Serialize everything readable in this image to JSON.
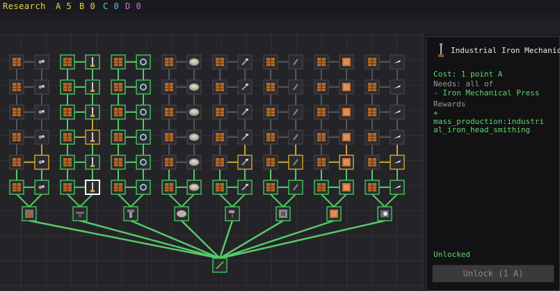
{
  "hud": {
    "research_label": "Research",
    "points": [
      {
        "label": "A 5",
        "color": "#e3d64a"
      },
      {
        "label": "B 0",
        "color": "#e3d64a"
      },
      {
        "label": "C 0",
        "color": "#4ec9d9"
      },
      {
        "label": "D 0",
        "color": "#c77ad8"
      }
    ]
  },
  "colors": {
    "unlocked_border": "#3fbf55",
    "available_border": "#c9a030",
    "locked_border": "#3e3e44",
    "selected_border": "#ffffff",
    "link_green": "#57c96b",
    "link_grey": "#55555a",
    "link_gold": "#c9a030"
  },
  "tree": {
    "columns": [
      {
        "icons": [
          "crate",
          "ore",
          "crate",
          "ore",
          "crate",
          "ore"
        ],
        "states": [
          "locked",
          "locked",
          "locked",
          "locked",
          "locked",
          "unlocked"
        ],
        "pair_state": [
          "locked",
          "locked",
          "locked",
          "locked",
          "available",
          "unlocked"
        ]
      },
      {
        "icons": [
          "crate",
          "rod",
          "crate",
          "rod",
          "crate",
          "rod"
        ],
        "states": [
          "unlocked",
          "unlocked",
          "unlocked",
          "unlocked",
          "unlocked",
          "unlocked"
        ],
        "pair_state": [
          "unlocked",
          "unlocked",
          "unlocked",
          "available",
          "unlocked",
          "selected"
        ]
      },
      {
        "icons": [
          "crate",
          "gear",
          "crate",
          "gear",
          "crate",
          "gear"
        ],
        "states": [
          "unlocked",
          "unlocked",
          "unlocked",
          "unlocked",
          "unlocked",
          "unlocked"
        ],
        "pair_state": [
          "unlocked",
          "unlocked",
          "unlocked",
          "unlocked",
          "unlocked",
          "unlocked"
        ]
      },
      {
        "icons": [
          "crate",
          "disc",
          "crate",
          "disc",
          "crate",
          "disc"
        ],
        "states": [
          "locked",
          "locked",
          "locked",
          "locked",
          "locked",
          "unlocked"
        ],
        "pair_state": [
          "locked",
          "locked",
          "locked",
          "locked",
          "locked",
          "unlocked"
        ]
      },
      {
        "icons": [
          "crate",
          "tool",
          "crate",
          "tool",
          "crate",
          "tool"
        ],
        "states": [
          "locked",
          "locked",
          "locked",
          "locked",
          "locked",
          "unlocked"
        ],
        "pair_state": [
          "locked",
          "locked",
          "locked",
          "locked",
          "available",
          "unlocked"
        ]
      },
      {
        "icons": [
          "crate",
          "stick",
          "crate",
          "stick",
          "crate",
          "stick"
        ],
        "states": [
          "locked",
          "locked",
          "locked",
          "locked",
          "locked",
          "unlocked"
        ],
        "pair_state": [
          "locked",
          "locked",
          "locked",
          "locked",
          "available",
          "unlocked"
        ]
      },
      {
        "icons": [
          "crate",
          "block",
          "crate",
          "block",
          "crate",
          "block"
        ],
        "states": [
          "locked",
          "locked",
          "locked",
          "locked",
          "locked",
          "unlocked"
        ],
        "pair_state": [
          "locked",
          "locked",
          "locked",
          "locked",
          "available",
          "unlocked"
        ]
      },
      {
        "icons": [
          "crate",
          "blade",
          "crate",
          "blade",
          "crate",
          "blade"
        ],
        "states": [
          "locked",
          "locked",
          "locked",
          "locked",
          "locked",
          "unlocked"
        ],
        "pair_state": [
          "locked",
          "locked",
          "locked",
          "locked",
          "available",
          "unlocked"
        ]
      }
    ],
    "root_icon": "staff",
    "bottom_icons": [
      "furnace",
      "anvil",
      "press",
      "grinder",
      "hammer",
      "machine",
      "block",
      "saw"
    ]
  },
  "panel": {
    "title": "Industrial Iron Mechanic",
    "cost": "Cost: 1 point A",
    "needs_header": "Needs: all of",
    "needs_item": "- Iron Mechanical Press",
    "rewards_header": "Rewards",
    "rewards_plus": "+",
    "rewards_line1": "mass_production:industri",
    "rewards_line2": "al_iron_head_smithing",
    "status": "Unlocked",
    "button_label": "Unlock (1 A)"
  }
}
